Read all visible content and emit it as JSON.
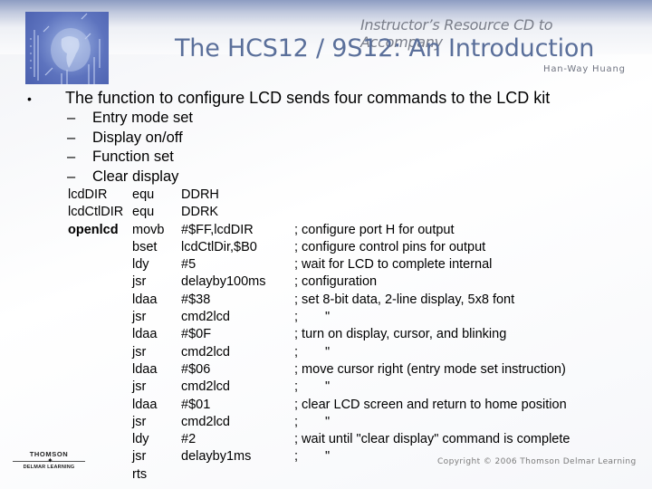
{
  "header": {
    "subtitle": "Instructor’s Resource CD to Accompany",
    "title": "The HCS12 / 9S12: An Introduction",
    "author": "Han-Way Huang",
    "logo_icon": "globe-circuit-icon"
  },
  "content": {
    "bullet": {
      "marker": "•",
      "text": "The function to configure LCD sends four commands to the LCD kit"
    },
    "subbullets": [
      {
        "marker": "–",
        "text": "Entry mode set"
      },
      {
        "marker": "–",
        "text": "Display on/off"
      },
      {
        "marker": "–",
        "text": "Function set"
      },
      {
        "marker": "–",
        "text": "Clear display"
      }
    ],
    "code": [
      {
        "label": "lcdDIR",
        "op": "equ",
        "arg": "DDRH",
        "comment": "",
        "bold": false
      },
      {
        "label": "lcdCtlDIR",
        "op": "equ",
        "arg": "DDRK",
        "comment": "",
        "bold": false
      },
      {
        "label": "openlcd",
        "op": "movb",
        "arg": "#$FF,lcdDIR",
        "comment": "; configure port H for output",
        "bold": true
      },
      {
        "label": "",
        "op": "bset",
        "arg": "lcdCtlDir,$B0",
        "comment": "; configure control pins for output"
      },
      {
        "label": "",
        "op": "ldy",
        "arg": "#5",
        "comment": "; wait for LCD to complete internal"
      },
      {
        "label": "",
        "op": "jsr",
        "arg": "delayby100ms",
        "comment": "; configuration"
      },
      {
        "label": "",
        "op": "ldaa",
        "arg": "#$38",
        "comment": "; set 8-bit data, 2-line display, 5x8 font"
      },
      {
        "label": "",
        "op": "jsr",
        "arg": "cmd2lcd",
        "comment": ";",
        "ditto": "\""
      },
      {
        "label": "",
        "op": "ldaa",
        "arg": "#$0F",
        "comment": "; turn on display, cursor, and blinking"
      },
      {
        "label": "",
        "op": "jsr",
        "arg": "cmd2lcd",
        "comment": ";",
        "ditto": "\""
      },
      {
        "label": "",
        "op": "ldaa",
        "arg": "#$06",
        "comment": "; move cursor right (entry mode set instruction)"
      },
      {
        "label": "",
        "op": "jsr",
        "arg": "cmd2lcd",
        "comment": ";",
        "ditto": "\""
      },
      {
        "label": "",
        "op": "ldaa",
        "arg": "#$01",
        "comment": "; clear LCD screen and return to home position"
      },
      {
        "label": "",
        "op": "jsr",
        "arg": "cmd2lcd",
        "comment": ";",
        "ditto": "\""
      },
      {
        "label": "",
        "op": "ldy",
        "arg": "#2",
        "comment": "; wait until \"clear display\" command is complete"
      },
      {
        "label": "",
        "op": "jsr",
        "arg": "delayby1ms",
        "comment": ";",
        "ditto": "\""
      },
      {
        "label": "",
        "op": "rts",
        "arg": "",
        "comment": ""
      }
    ]
  },
  "footer": {
    "publisher_line1": "THOMSON",
    "publisher_star": "✦",
    "publisher_line2": "DELMAR LEARNING",
    "copyright": "Copyright © 2006 Thomson Delmar Learning"
  }
}
